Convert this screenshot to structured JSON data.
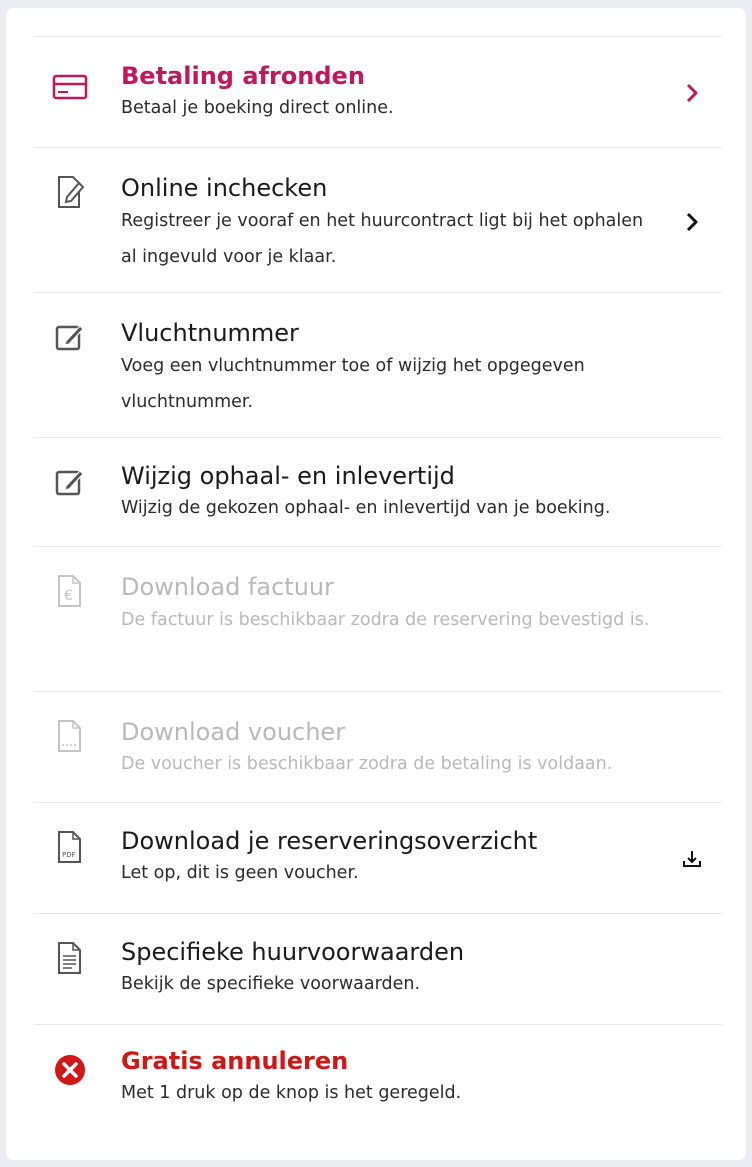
{
  "colors": {
    "pink": "#c2185b",
    "red": "#d31515",
    "disabled": "#b8b8b8",
    "text": "#1a1a1a"
  },
  "items": [
    {
      "title": "Betaling afronden",
      "subtitle": "Betaal je boeking direct online.",
      "icon": "credit-card-icon",
      "action": "chevron-right-icon",
      "state": "highlight"
    },
    {
      "title": "Online inchecken",
      "subtitle": "Registreer je vooraf en het huurcontract ligt bij het ophalen al ingevuld voor je klaar.",
      "icon": "document-edit-icon",
      "action": "chevron-right-icon",
      "state": "enabled"
    },
    {
      "title": "Vluchtnummer",
      "subtitle": "Voeg een vluchtnummer toe of wijzig het opgegeven vluchtnummer.",
      "icon": "edit-box-icon",
      "state": "enabled"
    },
    {
      "title": "Wijzig ophaal- en inlevertijd",
      "subtitle": "Wijzig de gekozen ophaal- en inlevertijd van je boeking.",
      "icon": "edit-box-icon",
      "state": "enabled"
    },
    {
      "title": "Download factuur",
      "subtitle": "De factuur is beschikbaar zodra de reservering bevestigd is.",
      "icon": "invoice-euro-icon",
      "state": "disabled"
    },
    {
      "title": "Download voucher",
      "subtitle": "De voucher is beschikbaar zodra de betaling is voldaan.",
      "icon": "voucher-document-icon",
      "state": "disabled"
    },
    {
      "title": "Download je reserveringsoverzicht",
      "subtitle": "Let op, dit is geen voucher.",
      "icon": "pdf-document-icon",
      "icon_label": "PDF",
      "action": "download-icon",
      "state": "enabled"
    },
    {
      "title": "Specifieke huurvoorwaarden",
      "subtitle": "Bekijk de specifieke voorwaarden.",
      "icon": "text-document-icon",
      "state": "enabled"
    },
    {
      "title": "Gratis annuleren",
      "subtitle": "Met 1 druk op de knop is het geregeld.",
      "icon": "cancel-circle-icon",
      "state": "danger"
    }
  ]
}
